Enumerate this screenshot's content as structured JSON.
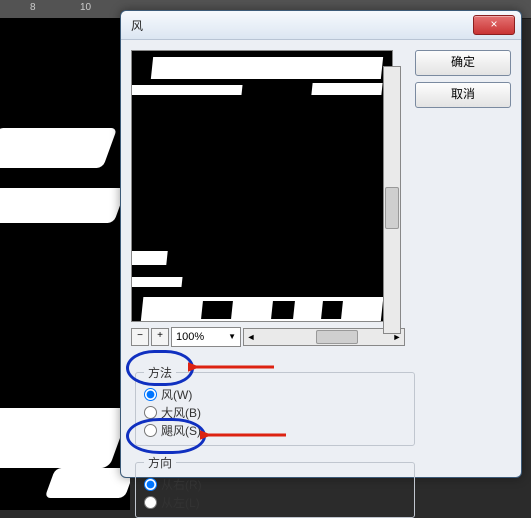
{
  "ruler": {
    "ticks": [
      "8",
      "10"
    ]
  },
  "dialog": {
    "title": "风",
    "close": "×",
    "ok": "确定",
    "cancel": "取消",
    "zoom": {
      "value": "100%"
    },
    "method": {
      "legend": "方法",
      "options": [
        {
          "label": "风(W)",
          "checked": true
        },
        {
          "label": "大风(B)",
          "checked": false
        },
        {
          "label": "飓风(S)",
          "checked": false
        }
      ]
    },
    "direction": {
      "legend": "方向",
      "options": [
        {
          "label": "从右(R)",
          "checked": true
        },
        {
          "label": "从左(L)",
          "checked": false
        }
      ]
    }
  }
}
